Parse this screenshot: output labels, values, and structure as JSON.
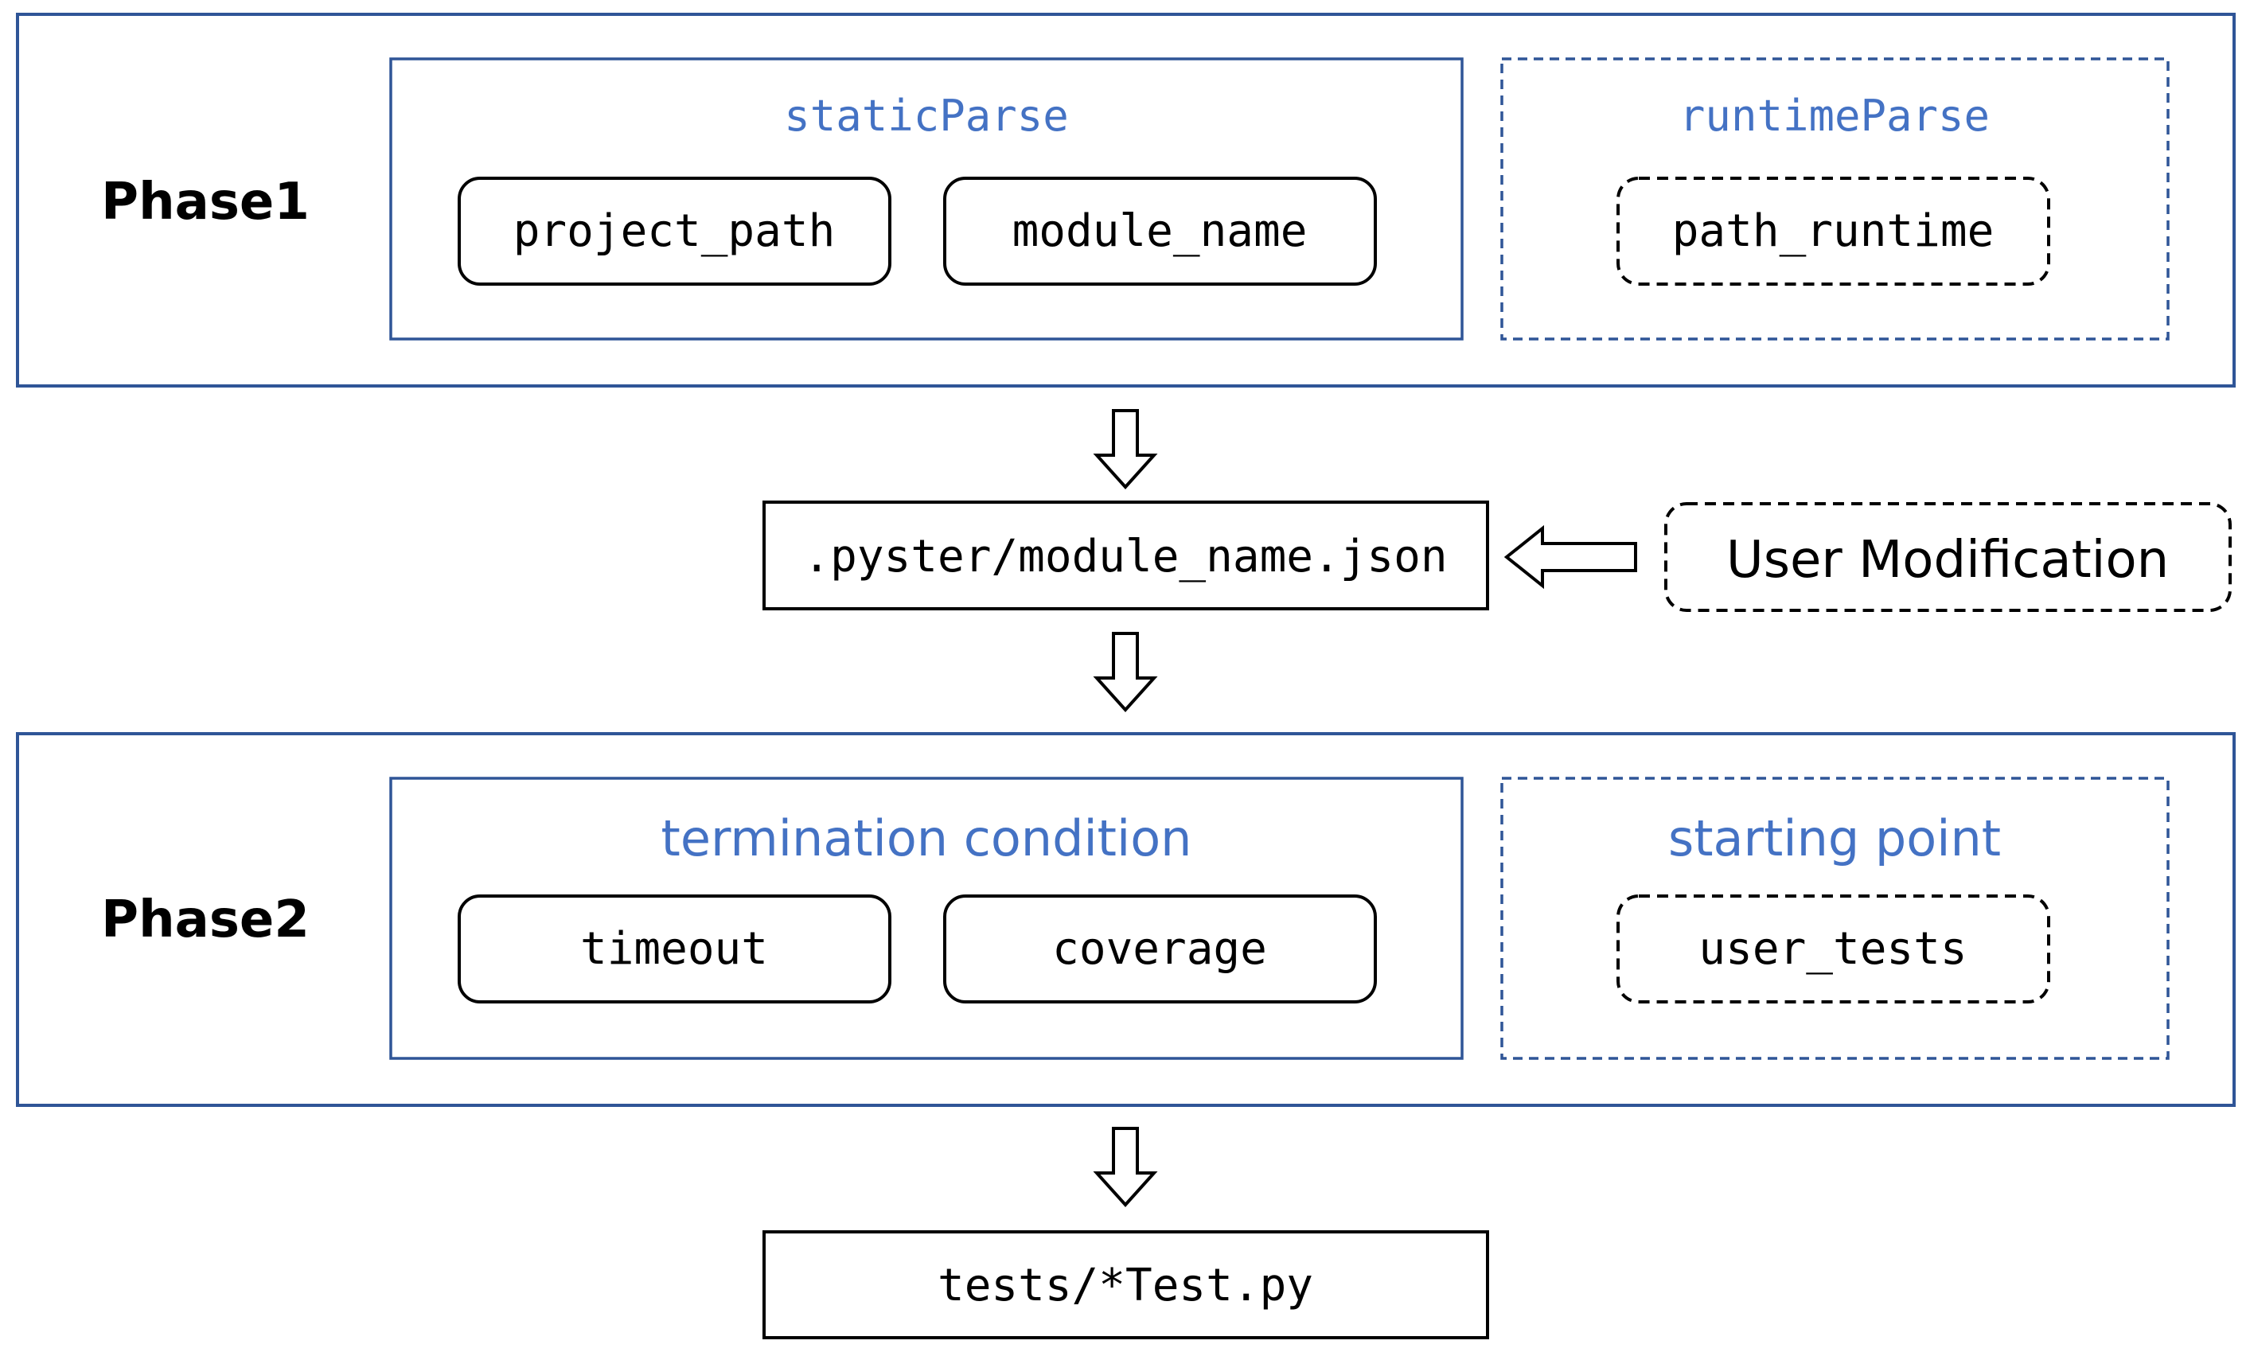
{
  "colors": {
    "frame": "#2F5597",
    "title": "#4472C4",
    "text": "#000000"
  },
  "phase1": {
    "label": "Phase1",
    "static_group": {
      "title": "staticParse",
      "items": [
        "project_path",
        "module_name"
      ]
    },
    "runtime_group": {
      "title": "runtimeParse",
      "items": [
        "path_runtime"
      ]
    }
  },
  "config_file": ".pyster/module_name.json",
  "user_modification": "User Modification",
  "phase2": {
    "label": "Phase2",
    "termination_group": {
      "title": "termination condition",
      "items": [
        "timeout",
        "coverage"
      ]
    },
    "starting_group": {
      "title": "starting point",
      "items": [
        "user_tests"
      ]
    }
  },
  "output_file": "tests/*Test.py"
}
